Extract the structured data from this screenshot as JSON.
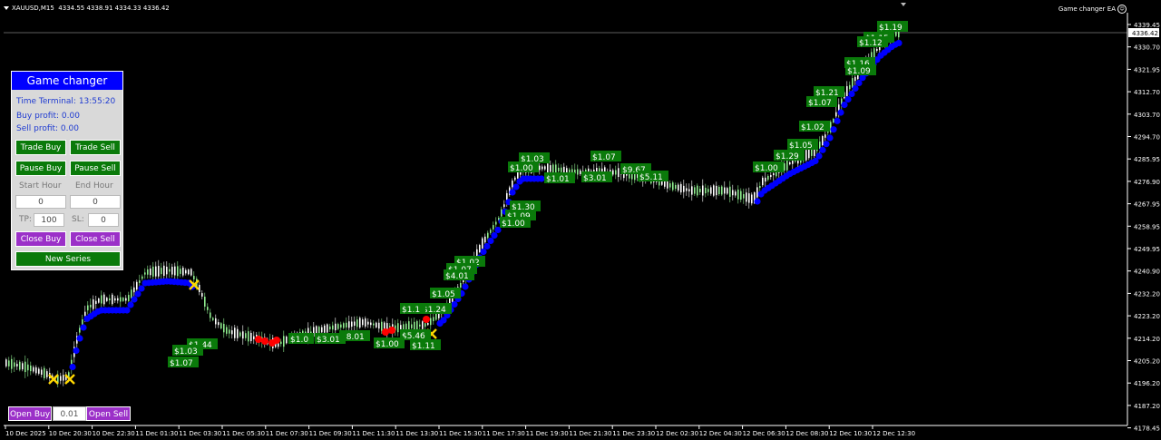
{
  "header": {
    "symbol": "XAUUSD,M15",
    "ohlc": "4334.55 4338.91 4334.33 4336.42"
  },
  "ea_label": "Game changer EA",
  "current_price": "4336.42",
  "panel": {
    "title": "Game changer",
    "time_terminal": "Time Terminal: 13:55:20",
    "buy_profit": "Buy profit: 0.00",
    "sell_profit": "Sell profit: 0.00",
    "trade_buy": "Trade Buy",
    "trade_sell": "Trade Sell",
    "pause_buy": "Pause Buy",
    "pause_sell": "Pause Sell",
    "start_hour_label": "Start Hour",
    "end_hour_label": "End Hour",
    "start_hour": "0",
    "end_hour": "0",
    "tp_label": "TP:",
    "tp": "100",
    "sl_label": "SL:",
    "sl": "0",
    "close_buy": "Close Buy",
    "close_sell": "Close Sell",
    "new_series": "New Series"
  },
  "bottom": {
    "open_buy": "Open Buy",
    "lot": "0.01",
    "open_sell": "Open Sell"
  },
  "colors": {
    "bg": "#000000",
    "bull": "#ffffff",
    "bear": "#90ee90",
    "ma": "#0000ff",
    "sell": "#ff0000",
    "profit_label": "#0a7a0a",
    "cross": "#ffd700"
  },
  "price_axis": [
    "4339.45",
    "4330.70",
    "4321.95",
    "4312.70",
    "4303.70",
    "4294.70",
    "4285.95",
    "4276.90",
    "4267.95",
    "4258.95",
    "4249.95",
    "4240.90",
    "4232.20",
    "4223.20",
    "4214.20",
    "4205.20",
    "4196.20",
    "4187.20",
    "4178.45"
  ],
  "time_axis": [
    "10 Dec 2025",
    "10 Dec 20:30",
    "10 Dec 22:30",
    "11 Dec 01:30",
    "11 Dec 03:30",
    "11 Dec 05:30",
    "11 Dec 07:30",
    "11 Dec 09:30",
    "11 Dec 11:30",
    "11 Dec 13:30",
    "11 Dec 15:30",
    "11 Dec 17:30",
    "11 Dec 19:30",
    "11 Dec 21:30",
    "11 Dec 23:30",
    "12 Dec 02:30",
    "12 Dec 04:30",
    "12 Dec 06:30",
    "12 Dec 08:30",
    "12 Dec 10:30",
    "12 Dec 12:30"
  ],
  "profit_labels": [
    "$1.19",
    "$1.15",
    "$1.12",
    "$1.16",
    "$1.09",
    "$1.21",
    "$1.07",
    "$1.02",
    "$1.05",
    "$1.29",
    "$1.00",
    "$1.07",
    "$1.03",
    "$1.00",
    "$1.01",
    "$3.01",
    "$9.67",
    "$5.11",
    "$1.30",
    "$1.09",
    "$1.00",
    "$1.02",
    "$1.07",
    "$4.01",
    "$1.05",
    "$1.24",
    "$1.1",
    "$5.46",
    "$1.11",
    "$1.00",
    "$8.01",
    "$3.01",
    "$1.0",
    "$1.44",
    "$1.03",
    "$1.07"
  ]
}
